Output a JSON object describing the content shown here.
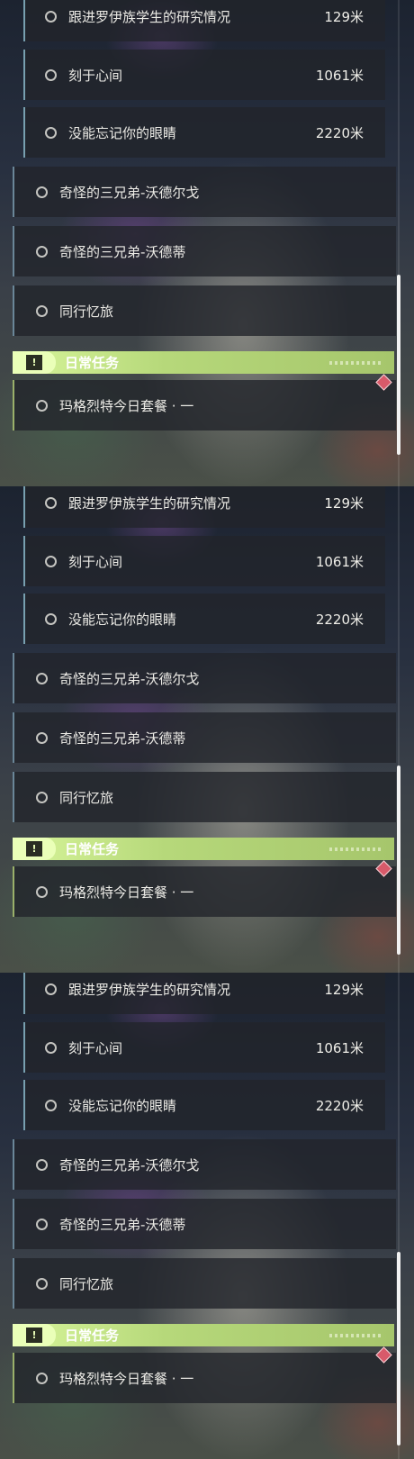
{
  "panels": [
    {
      "side_quests": [
        {
          "label": "跟进罗伊族学生的研究情况",
          "distance": "129米"
        },
        {
          "label": "刻于心间",
          "distance": "1061米"
        },
        {
          "label": "没能忘记你的眼睛",
          "distance": "2220米"
        }
      ],
      "main_quests": [
        {
          "label": "奇怪的三兄弟-沃德尔戈"
        },
        {
          "label": "奇怪的三兄弟-沃德蒂"
        },
        {
          "label": "同行忆旅"
        }
      ],
      "daily_header": "日常任务",
      "daily_quests": [
        {
          "label": "玛格烈特今日套餐 · 一"
        }
      ]
    },
    {
      "side_quests": [
        {
          "label": "跟进罗伊族学生的研究情况",
          "distance": "129米"
        },
        {
          "label": "刻于心间",
          "distance": "1061米"
        },
        {
          "label": "没能忘记你的眼睛",
          "distance": "2220米"
        }
      ],
      "main_quests": [
        {
          "label": "奇怪的三兄弟-沃德尔戈"
        },
        {
          "label": "奇怪的三兄弟-沃德蒂"
        },
        {
          "label": "同行忆旅"
        }
      ],
      "daily_header": "日常任务",
      "daily_quests": [
        {
          "label": "玛格烈特今日套餐 · 一"
        }
      ]
    },
    {
      "side_quests": [
        {
          "label": "跟进罗伊族学生的研究情况",
          "distance": "129米"
        },
        {
          "label": "刻于心间",
          "distance": "1061米"
        },
        {
          "label": "没能忘记你的眼睛",
          "distance": "2220米"
        }
      ],
      "main_quests": [
        {
          "label": "奇怪的三兄弟-沃德尔戈"
        },
        {
          "label": "奇怪的三兄弟-沃德蒂"
        },
        {
          "label": "同行忆旅"
        }
      ],
      "daily_header": "日常任务",
      "daily_quests": [
        {
          "label": "玛格烈特今日套餐 · 一"
        }
      ]
    }
  ],
  "icons": {
    "status": "circle-outline-icon",
    "daily": "exclamation-icon",
    "marker": "red-diamond-icon"
  },
  "colors": {
    "daily_header": "#b6d87a",
    "marker": "#d85a6a"
  }
}
